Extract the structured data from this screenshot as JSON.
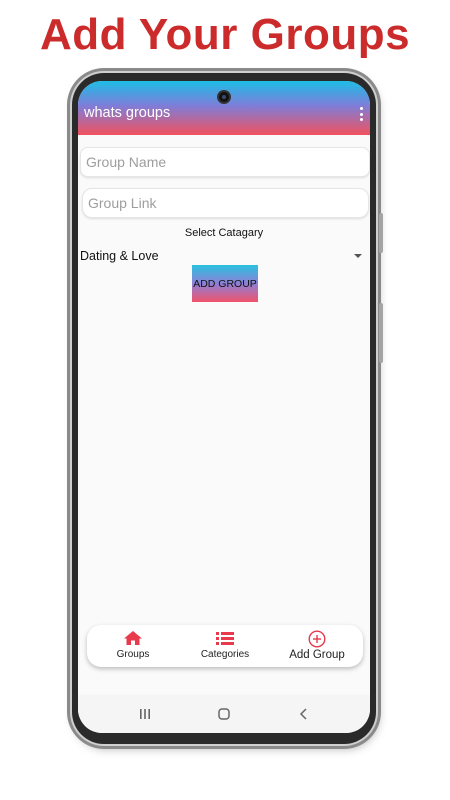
{
  "headline": "Add Your Groups",
  "app": {
    "title": "whats groups",
    "accent_color": "#f1515e",
    "gradient_colors": [
      "#1dbde6",
      "#7d7ed9",
      "#f1515e"
    ]
  },
  "form": {
    "group_name_placeholder": "Group Name",
    "group_link_placeholder": "Group Link",
    "category_label": "Select Catagary",
    "category_selected": "Dating & Love",
    "submit_label": "ADD GROUP"
  },
  "bottom_nav": {
    "items": [
      {
        "label": "Groups",
        "icon": "home-icon"
      },
      {
        "label": "Categories",
        "icon": "list-icon"
      },
      {
        "label": "Add Group",
        "icon": "add-circle-icon"
      }
    ]
  },
  "system_nav": {
    "icons": [
      "recents-icon",
      "home-button-icon",
      "back-icon"
    ]
  }
}
